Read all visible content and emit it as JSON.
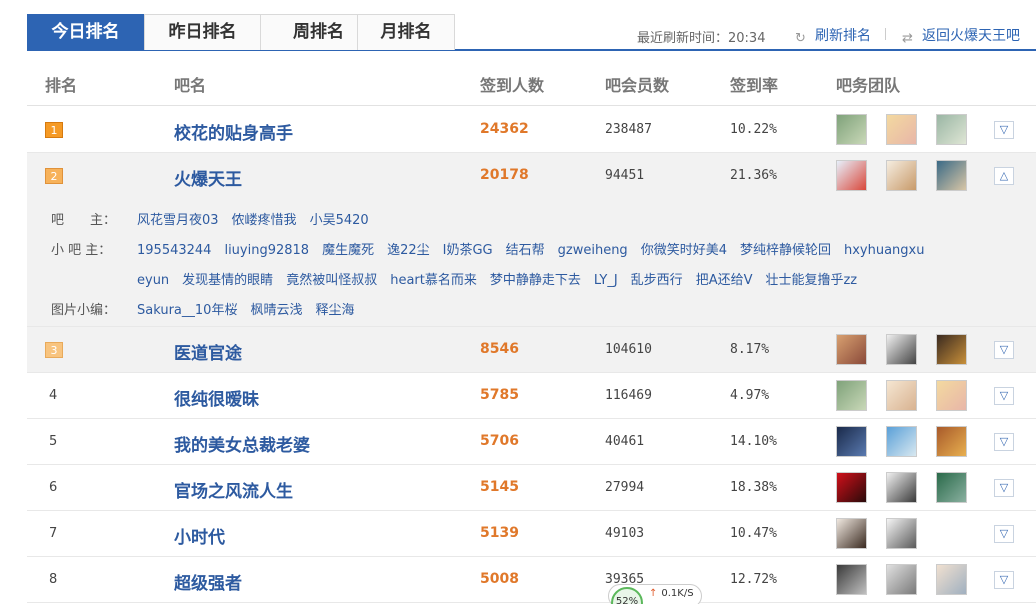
{
  "tabs": [
    {
      "label": "今日排名",
      "active": true
    },
    {
      "label": "昨日排名",
      "active": false
    },
    {
      "label": "周排名",
      "active": false
    },
    {
      "label": "月排名",
      "active": false
    }
  ],
  "refresh": {
    "time_label": "最近刷新时间：20:34",
    "refresh_label": "刷新排名",
    "back_label": "返回火爆天王吧"
  },
  "columns": {
    "rank": "排名",
    "name": "吧名",
    "signed": "签到人数",
    "members": "吧会员数",
    "rate": "签到率",
    "team": "吧务团队"
  },
  "rows": [
    {
      "rank": "1",
      "name": "校花的贴身高手",
      "signed": "24362",
      "members": "238487",
      "rate": "10.22%",
      "expanded": false
    },
    {
      "rank": "2",
      "name": "火爆天王",
      "signed": "20178",
      "members": "94451",
      "rate": "21.36%",
      "expanded": true
    },
    {
      "rank": "3",
      "name": "医道官途",
      "signed": "8546",
      "members": "104610",
      "rate": "8.17%",
      "expanded": false
    },
    {
      "rank": "4",
      "name": "很纯很暧昧",
      "signed": "5785",
      "members": "116469",
      "rate": "4.97%",
      "expanded": false
    },
    {
      "rank": "5",
      "name": "我的美女总裁老婆",
      "signed": "5706",
      "members": "40461",
      "rate": "14.10%",
      "expanded": false
    },
    {
      "rank": "6",
      "name": "官场之风流人生",
      "signed": "5145",
      "members": "27994",
      "rate": "18.38%",
      "expanded": false
    },
    {
      "rank": "7",
      "name": "小时代",
      "signed": "5139",
      "members": "49103",
      "rate": "10.47%",
      "expanded": false
    },
    {
      "rank": "8",
      "name": "超级强者",
      "signed": "5008",
      "members": "39365",
      "rate": "12.72%",
      "expanded": false
    }
  ],
  "detail": {
    "owner_label": "吧　　主：",
    "owners": [
      "风花雪月夜03",
      "侬嵝疼惜我",
      "小吴5420"
    ],
    "sub_label": "小 吧 主：",
    "subs_line1": [
      "195543244",
      "liuying92818",
      "魔生魔死",
      "逸22尘",
      "I奶茶GG",
      "结石帮",
      "gzweiheng",
      "你微笑时好美4",
      "梦纯梓静候轮回",
      "hxyhuangxu"
    ],
    "subs_line2": [
      "eyun",
      "发现基情的眼睛",
      "竟然被叫怪叔叔",
      "heart慕名而来",
      "梦中静静走下去",
      "LY_J",
      "乱步西行",
      "把A还给V",
      "壮士能复撸乎zz"
    ],
    "pic_label": "图片小编：",
    "pic_editors": [
      "Sakura__10年桜",
      "枫晴云浅",
      "释尘海"
    ]
  },
  "speed": {
    "percent": "52%",
    "rate": "0.1K/S"
  },
  "icons": {
    "refresh": "refresh-icon",
    "back": "back-icon",
    "expand": "chevron-down-icon",
    "collapse": "chevron-up-icon"
  },
  "colors": {
    "accent": "#2d64b3",
    "signed": "#e0782a",
    "link": "#2d5aa0"
  }
}
